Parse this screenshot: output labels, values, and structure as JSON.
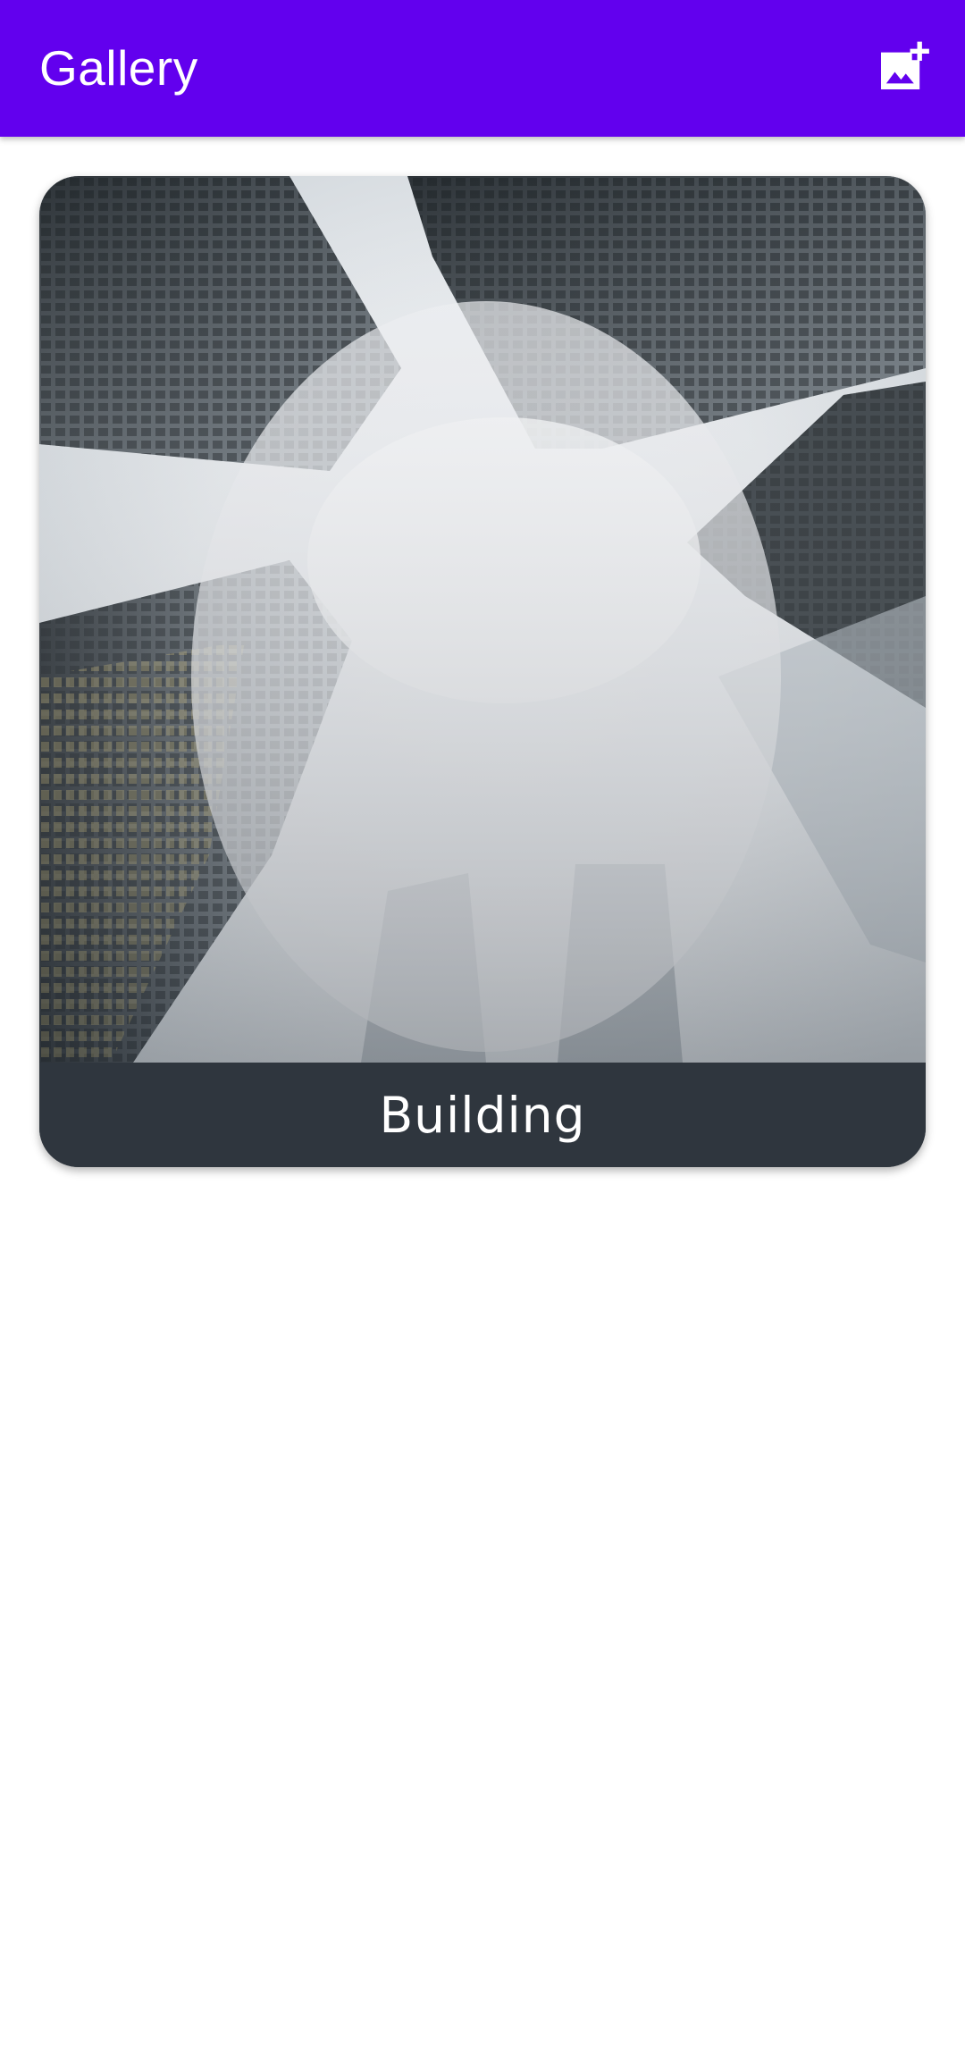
{
  "app_bar": {
    "title": "Gallery",
    "background_color": "#6200EE",
    "action_icon": "add-photo-icon"
  },
  "gallery": {
    "items": [
      {
        "caption": "Building",
        "image_icon": "skyscrapers-photo",
        "caption_background": "#2F363E"
      }
    ]
  }
}
